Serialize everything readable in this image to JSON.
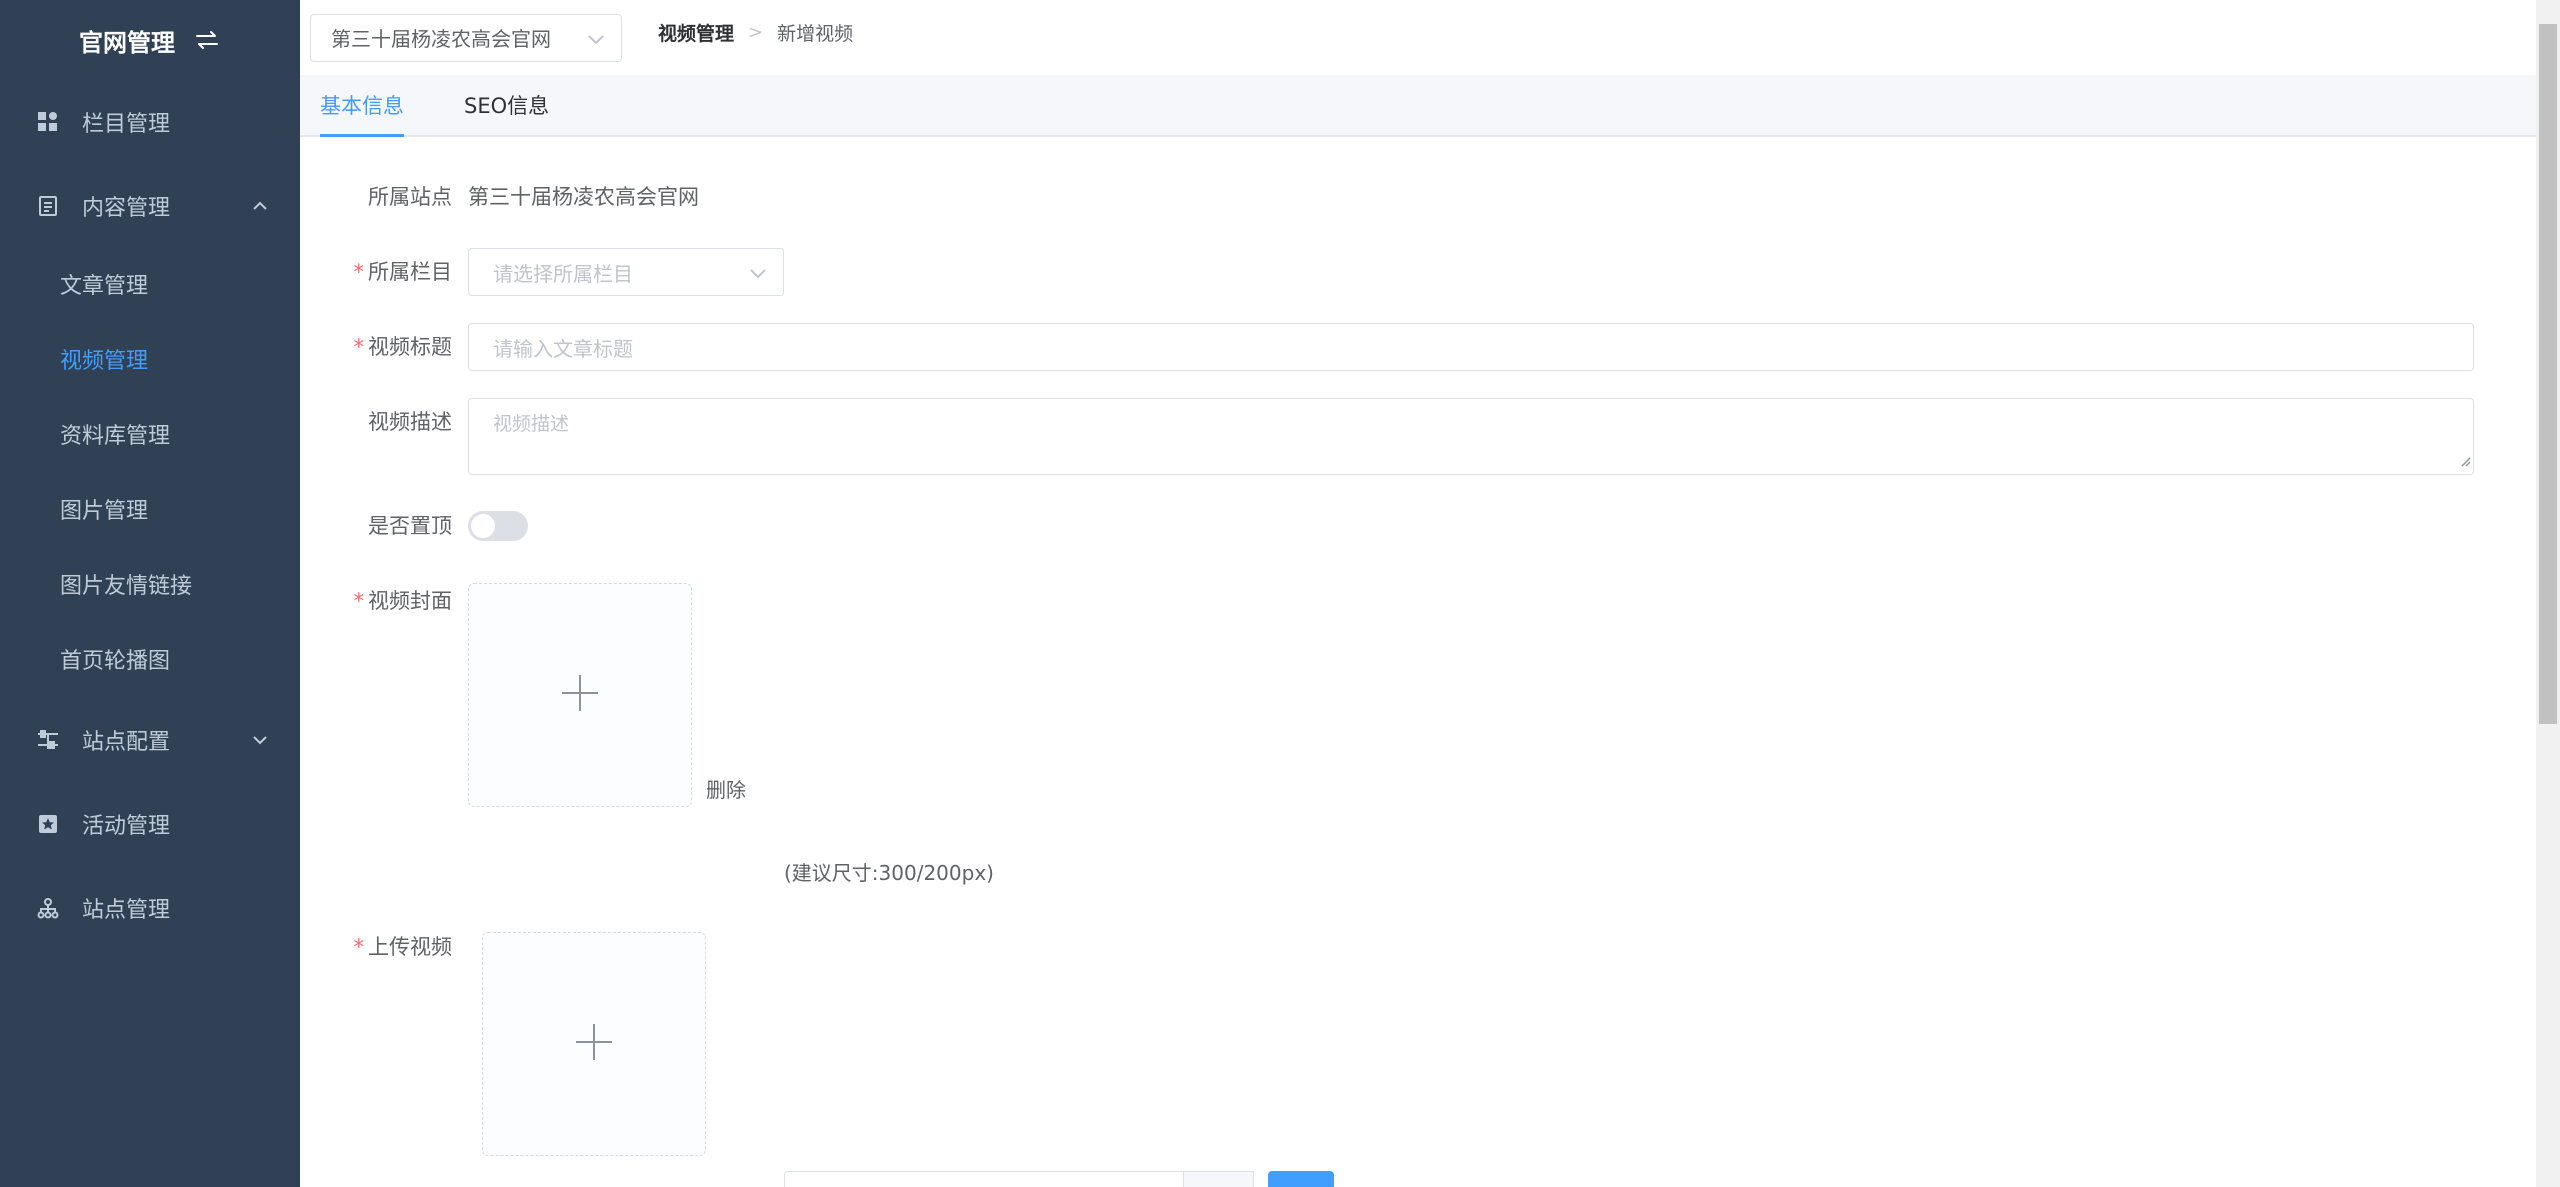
{
  "sidebar": {
    "title": "官网管理",
    "menu": [
      {
        "label": "栏目管理",
        "icon": "column-grid-icon"
      },
      {
        "label": "内容管理",
        "icon": "document-icon",
        "expanded": true
      },
      {
        "label": "站点配置",
        "icon": "sliders-icon",
        "expanded": false
      },
      {
        "label": "活动管理",
        "icon": "activity-icon"
      },
      {
        "label": "站点管理",
        "icon": "sitemap-icon"
      }
    ],
    "submenu": [
      {
        "label": "文章管理"
      },
      {
        "label": "视频管理",
        "active": true
      },
      {
        "label": "资料库管理"
      },
      {
        "label": "图片管理"
      },
      {
        "label": "图片友情链接"
      },
      {
        "label": "首页轮播图"
      }
    ]
  },
  "topbar": {
    "site_select_value": "第三十届杨凌农高会官网",
    "breadcrumb": [
      "视频管理",
      "新增视频"
    ]
  },
  "tabs": [
    {
      "label": "基本信息",
      "active": true
    },
    {
      "label": "SEO信息",
      "active": false
    }
  ],
  "form": {
    "site": {
      "label": "所属站点",
      "value": "第三十届杨凌农高会官网"
    },
    "column": {
      "label": "所属栏目",
      "placeholder": "请选择所属栏目",
      "required": true
    },
    "title": {
      "label": "视频标题",
      "placeholder": "请输入文章标题",
      "required": true
    },
    "description": {
      "label": "视频描述",
      "placeholder": "视频描述"
    },
    "pinned": {
      "label": "是否置顶",
      "value": false
    },
    "cover": {
      "label": "视频封面",
      "required": true,
      "delete_label": "删除",
      "hint": "(建议尺寸:300/200px)"
    },
    "upload": {
      "label": "上传视频",
      "required": true
    }
  },
  "colors": {
    "sidebar_bg": "#304156",
    "accent": "#409eff",
    "required": "#f56c6c"
  }
}
